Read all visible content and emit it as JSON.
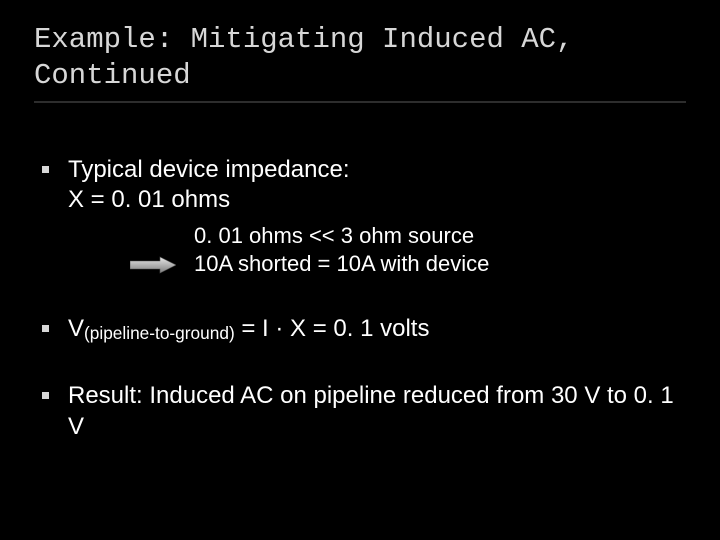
{
  "title": "Example: Mitigating Induced AC, Continued",
  "bullets": {
    "b1_line1": "Typical device impedance:",
    "b1_line2": "X = 0. 01 ohms",
    "b1_sub1": "0. 01 ohms << 3 ohm source",
    "b1_sub2": "10A shorted = 10A with device",
    "b2_pre": "V",
    "b2_sub": "(pipeline-to-ground)",
    "b2_post": " = I · X = 0. 1 volts",
    "b3": "Result: Induced AC on pipeline reduced from 30 V to 0. 1 V"
  }
}
